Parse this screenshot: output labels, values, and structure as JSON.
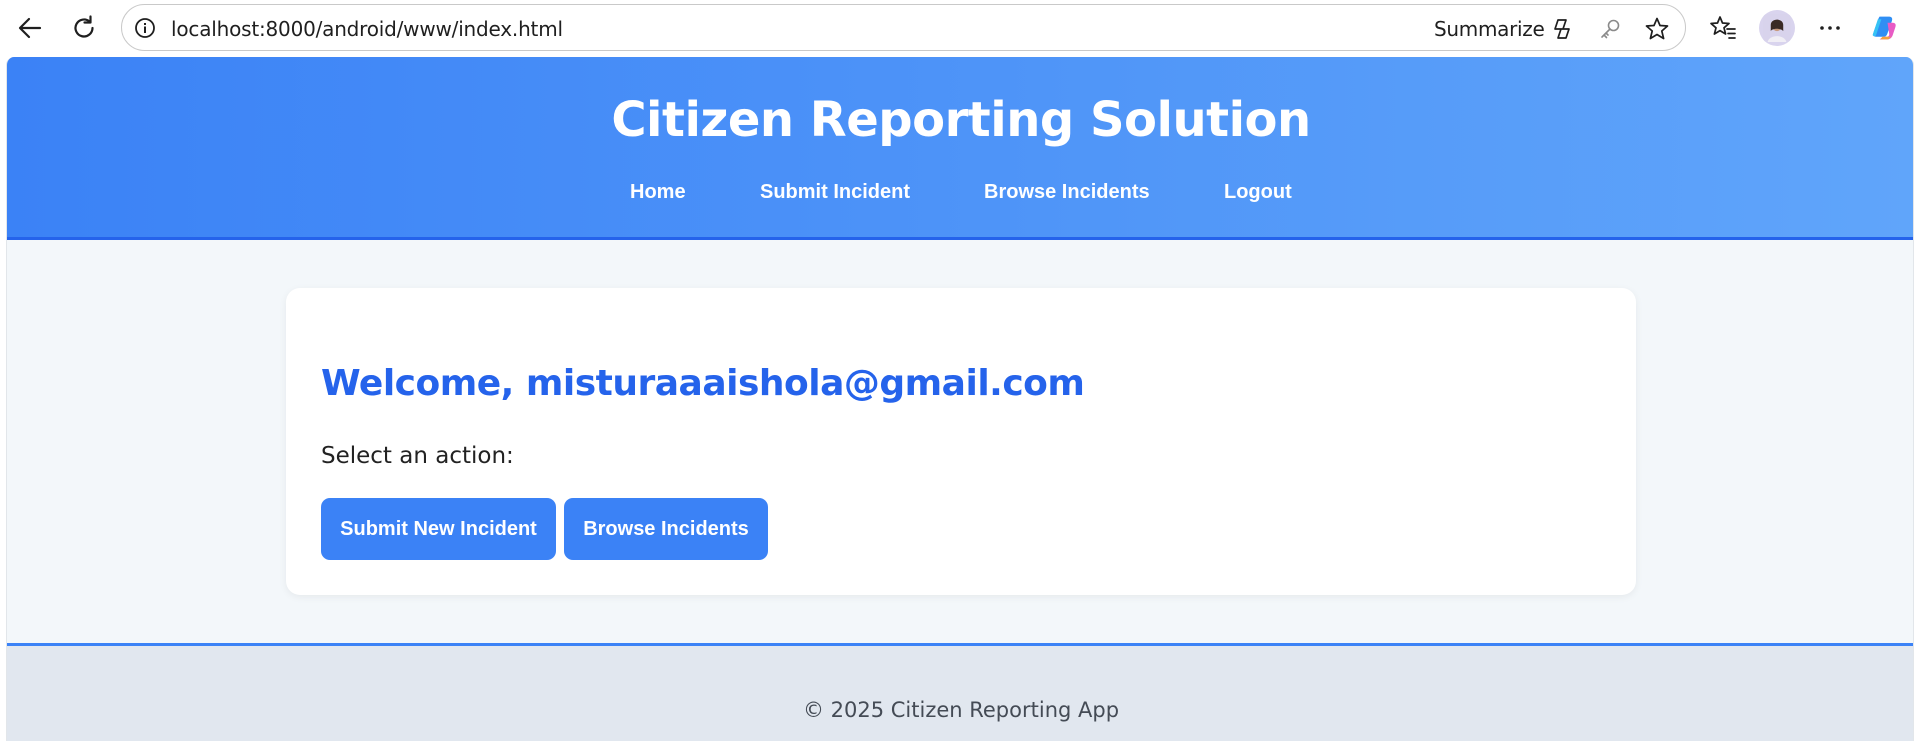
{
  "browser": {
    "url": "localhost:8000/android/www/index.html",
    "summarize_label": "Summarize",
    "icons": {
      "back": "back-arrow-icon",
      "reload": "reload-icon",
      "info": "info-icon",
      "copilot_small": "copilot-icon",
      "key": "key-icon",
      "star": "star-icon",
      "favorites": "favorites-icon",
      "avatar": "profile-avatar",
      "more": "more-icon",
      "copilot": "copilot-icon"
    }
  },
  "header": {
    "title": "Citizen Reporting Solution",
    "nav": [
      {
        "label": "Home"
      },
      {
        "label": "Submit Incident"
      },
      {
        "label": "Browse Incidents"
      },
      {
        "label": "Logout"
      }
    ]
  },
  "main": {
    "welcome": "Welcome, misturaaaishola@gmail.com",
    "prompt": "Select an action:",
    "buttons": [
      {
        "label": "Submit New Incident"
      },
      {
        "label": "Browse Incidents"
      }
    ]
  },
  "footer": {
    "text": "© 2025 Citizen Reporting App"
  },
  "colors": {
    "header_start": "#3b82f6",
    "header_end": "#60a5fa",
    "accent": "#2563eb",
    "button": "#3b82f6",
    "page_bg": "#f3f7fa",
    "footer_bg": "#e1e7ef"
  }
}
